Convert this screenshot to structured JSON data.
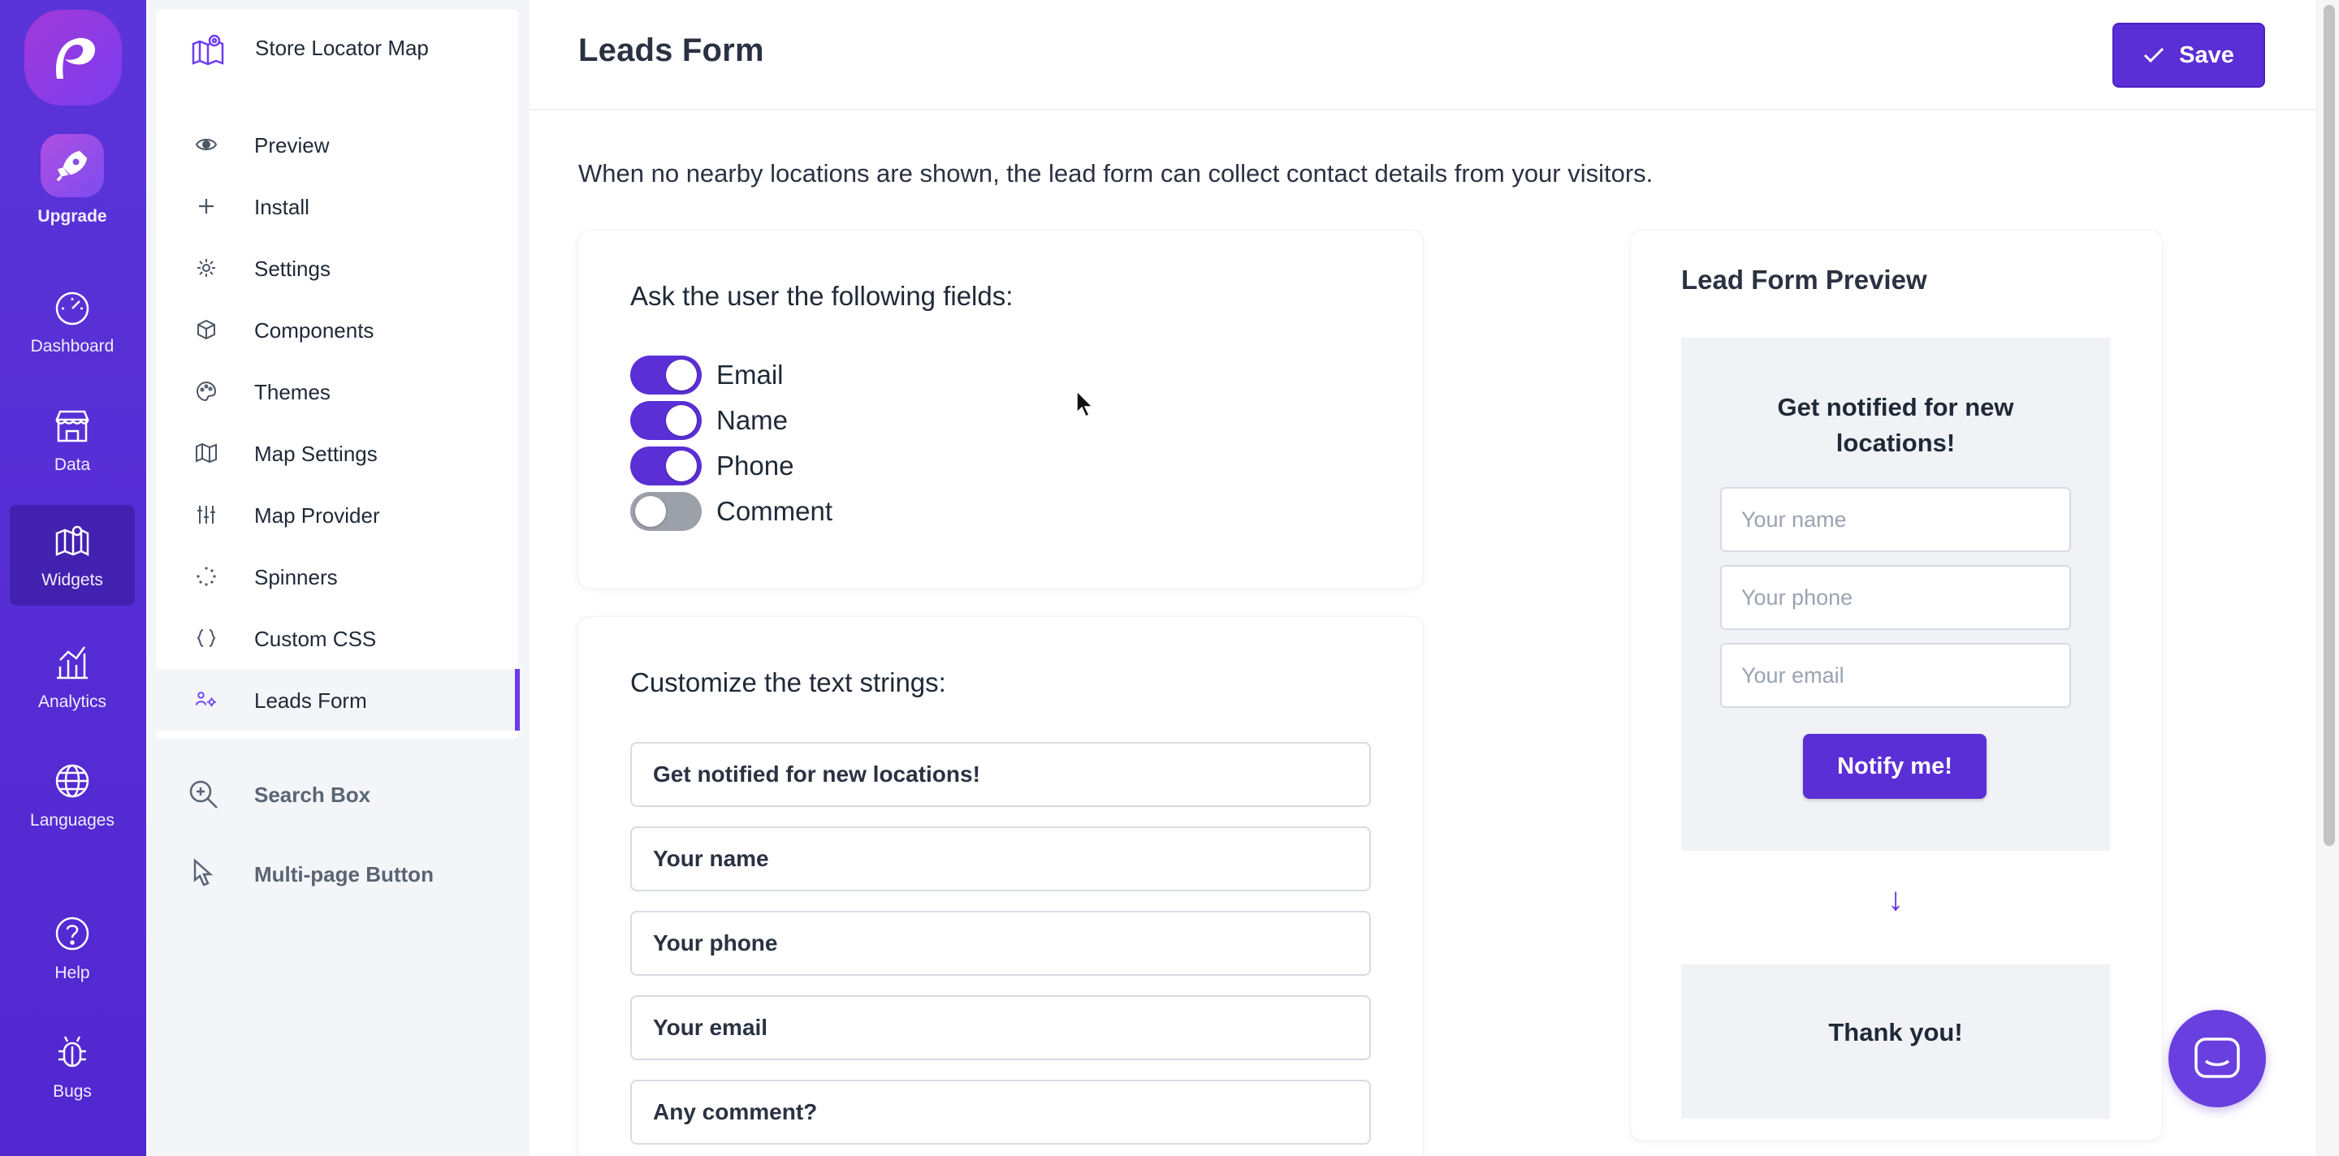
{
  "rail": {
    "items": [
      {
        "label": "Upgrade"
      },
      {
        "label": "Dashboard"
      },
      {
        "label": "Data"
      },
      {
        "label": "Widgets"
      },
      {
        "label": "Analytics"
      },
      {
        "label": "Languages"
      },
      {
        "label": "Help"
      },
      {
        "label": "Bugs"
      }
    ],
    "active": "Widgets"
  },
  "sidebar": {
    "widget_name": "Store Locator Map",
    "items": [
      {
        "label": "Preview",
        "icon": "eye-icon"
      },
      {
        "label": "Install",
        "icon": "plus-icon"
      },
      {
        "label": "Settings",
        "icon": "gear-icon"
      },
      {
        "label": "Components",
        "icon": "cube-icon"
      },
      {
        "label": "Themes",
        "icon": "palette-icon"
      },
      {
        "label": "Map Settings",
        "icon": "map-icon"
      },
      {
        "label": "Map Provider",
        "icon": "sliders-icon"
      },
      {
        "label": "Spinners",
        "icon": "spinner-icon"
      },
      {
        "label": "Custom CSS",
        "icon": "braces-icon"
      },
      {
        "label": "Leads Form",
        "icon": "users-gear-icon"
      }
    ],
    "active": "Leads Form",
    "other_widgets": [
      {
        "label": "Search Box",
        "icon": "zoom-icon"
      },
      {
        "label": "Multi-page Button",
        "icon": "pointer-icon"
      }
    ]
  },
  "header": {
    "title": "Leads Form",
    "save_label": "Save"
  },
  "intro_text": "When no nearby locations are shown, the lead form can collect contact details from your visitors.",
  "fields_card": {
    "title": "Ask the user the following fields:",
    "toggles": [
      {
        "label": "Email",
        "on": true
      },
      {
        "label": "Name",
        "on": true
      },
      {
        "label": "Phone",
        "on": true
      },
      {
        "label": "Comment",
        "on": false
      }
    ]
  },
  "strings_card": {
    "title": "Customize the text strings:",
    "values": [
      "Get notified for new locations!",
      "Your name",
      "Your phone",
      "Your email",
      "Any comment?"
    ]
  },
  "preview": {
    "title": "Lead Form Preview",
    "heading": "Get notified for new locations!",
    "name_placeholder": "Your name",
    "phone_placeholder": "Your phone",
    "email_placeholder": "Your email",
    "button": "Notify me!",
    "arrow": "↓",
    "thank_you": "Thank you!"
  },
  "colors": {
    "accent": "#5b2fd6",
    "rail": "#5a34d9"
  }
}
